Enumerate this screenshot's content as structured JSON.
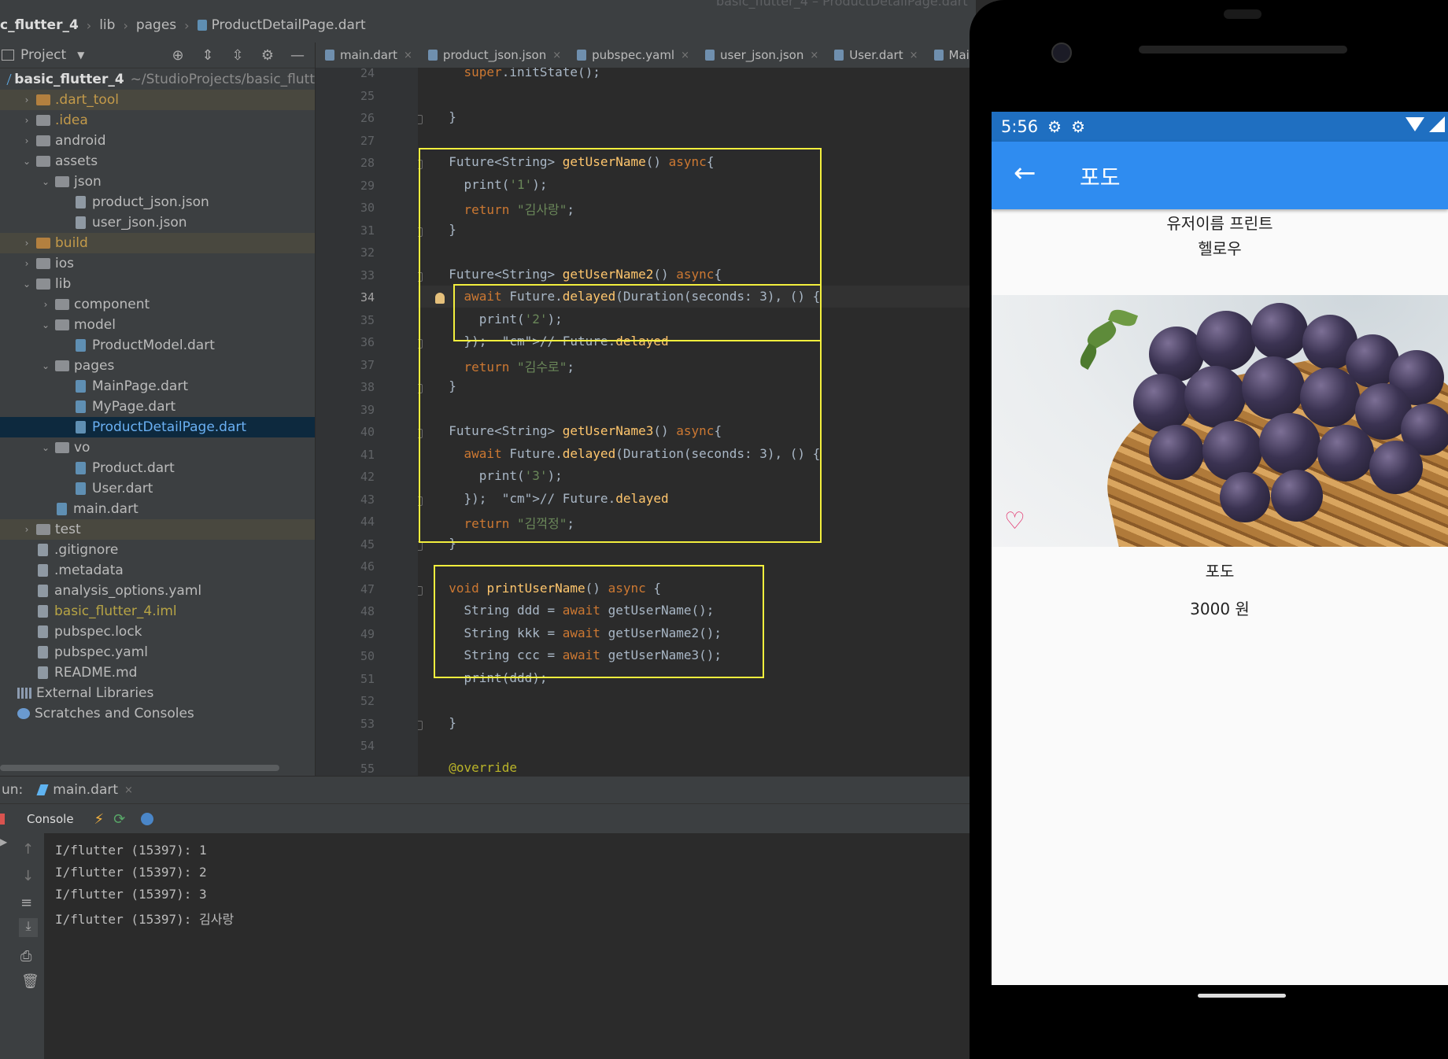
{
  "breadcrumb": [
    "c_flutter_4",
    "lib",
    "pages",
    "ProductDetailPage.dart"
  ],
  "window_title_faint": "basic_flutter_4 – ProductDetailPage.dart",
  "project_pane": {
    "title": "Project",
    "tree": [
      {
        "label": "basic_flutter_4",
        "suffix": "~/StudioProjects/basic_flutt",
        "depth": 0,
        "arrow": "",
        "icon": "flutter",
        "bold": true
      },
      {
        "label": ".dart_tool",
        "depth": 1,
        "arrow": "›",
        "icon": "folder-orange",
        "style": "orange",
        "excluded": true
      },
      {
        "label": ".idea",
        "depth": 1,
        "arrow": "›",
        "icon": "folder",
        "style": "orange"
      },
      {
        "label": "android",
        "depth": 1,
        "arrow": "›",
        "icon": "folder"
      },
      {
        "label": "assets",
        "depth": 1,
        "arrow": "⌄",
        "icon": "folder"
      },
      {
        "label": "json",
        "depth": 2,
        "arrow": "⌄",
        "icon": "folder"
      },
      {
        "label": "product_json.json",
        "depth": 3,
        "arrow": "",
        "icon": "file"
      },
      {
        "label": "user_json.json",
        "depth": 3,
        "arrow": "",
        "icon": "file"
      },
      {
        "label": "build",
        "depth": 1,
        "arrow": "›",
        "icon": "folder-orange",
        "style": "orange",
        "excluded": true
      },
      {
        "label": "ios",
        "depth": 1,
        "arrow": "›",
        "icon": "folder"
      },
      {
        "label": "lib",
        "depth": 1,
        "arrow": "⌄",
        "icon": "folder"
      },
      {
        "label": "component",
        "depth": 2,
        "arrow": "›",
        "icon": "folder"
      },
      {
        "label": "model",
        "depth": 2,
        "arrow": "⌄",
        "icon": "folder"
      },
      {
        "label": "ProductModel.dart",
        "depth": 3,
        "arrow": "",
        "icon": "dart"
      },
      {
        "label": "pages",
        "depth": 2,
        "arrow": "⌄",
        "icon": "folder"
      },
      {
        "label": "MainPage.dart",
        "depth": 3,
        "arrow": "",
        "icon": "dart"
      },
      {
        "label": "MyPage.dart",
        "depth": 3,
        "arrow": "",
        "icon": "dart"
      },
      {
        "label": "ProductDetailPage.dart",
        "depth": 3,
        "arrow": "",
        "icon": "dart",
        "style": "blue",
        "selected": true
      },
      {
        "label": "vo",
        "depth": 2,
        "arrow": "⌄",
        "icon": "folder"
      },
      {
        "label": "Product.dart",
        "depth": 3,
        "arrow": "",
        "icon": "dart"
      },
      {
        "label": "User.dart",
        "depth": 3,
        "arrow": "",
        "icon": "dart"
      },
      {
        "label": "main.dart",
        "depth": 2,
        "arrow": "",
        "icon": "dart"
      },
      {
        "label": "test",
        "depth": 1,
        "arrow": "›",
        "icon": "folder",
        "excluded": true
      },
      {
        "label": ".gitignore",
        "depth": 1,
        "arrow": "",
        "icon": "file"
      },
      {
        "label": ".metadata",
        "depth": 1,
        "arrow": "",
        "icon": "file"
      },
      {
        "label": "analysis_options.yaml",
        "depth": 1,
        "arrow": "",
        "icon": "file"
      },
      {
        "label": "basic_flutter_4.iml",
        "depth": 1,
        "arrow": "",
        "icon": "file",
        "style": "gold"
      },
      {
        "label": "pubspec.lock",
        "depth": 1,
        "arrow": "",
        "icon": "file"
      },
      {
        "label": "pubspec.yaml",
        "depth": 1,
        "arrow": "",
        "icon": "file"
      },
      {
        "label": "README.md",
        "depth": 1,
        "arrow": "",
        "icon": "file"
      },
      {
        "label": "External Libraries",
        "depth": 0,
        "arrow": "",
        "icon": "libs"
      },
      {
        "label": "Scratches and Consoles",
        "depth": 0,
        "arrow": "",
        "icon": "scratch"
      }
    ]
  },
  "editor_tabs": [
    "main.dart",
    "product_json.json",
    "pubspec.yaml",
    "user_json.json",
    "User.dart",
    "MainP"
  ],
  "code": {
    "current_line": "34",
    "lines": [
      {
        "n": "24",
        "t": "    super.initState();"
      },
      {
        "n": "25",
        "t": ""
      },
      {
        "n": "26",
        "t": "  }"
      },
      {
        "n": "27",
        "t": ""
      },
      {
        "n": "28",
        "t": "  Future<String> getUserName() async{"
      },
      {
        "n": "29",
        "t": "    print('1');"
      },
      {
        "n": "30",
        "t": "    return \"김사랑\";"
      },
      {
        "n": "31",
        "t": "  }"
      },
      {
        "n": "32",
        "t": ""
      },
      {
        "n": "33",
        "t": "  Future<String> getUserName2() async{"
      },
      {
        "n": "34",
        "t": "    await Future.delayed(Duration(seconds: 3), () {"
      },
      {
        "n": "35",
        "t": "      print('2');"
      },
      {
        "n": "36",
        "t": "    });  // Future.delayed"
      },
      {
        "n": "37",
        "t": "    return \"김수로\";"
      },
      {
        "n": "38",
        "t": "  }"
      },
      {
        "n": "39",
        "t": ""
      },
      {
        "n": "40",
        "t": "  Future<String> getUserName3() async{"
      },
      {
        "n": "41",
        "t": "    await Future.delayed(Duration(seconds: 3), () {"
      },
      {
        "n": "42",
        "t": "      print('3');"
      },
      {
        "n": "43",
        "t": "    });  // Future.delayed"
      },
      {
        "n": "44",
        "t": "    return \"김꺽정\";"
      },
      {
        "n": "45",
        "t": "  }"
      },
      {
        "n": "46",
        "t": ""
      },
      {
        "n": "47",
        "t": "  void printUserName() async {"
      },
      {
        "n": "48",
        "t": "    String ddd = await getUserName();"
      },
      {
        "n": "49",
        "t": "    String kkk = await getUserName2();"
      },
      {
        "n": "50",
        "t": "    String ccc = await getUserName3();"
      },
      {
        "n": "51",
        "t": "    print(ddd);"
      },
      {
        "n": "52",
        "t": ""
      },
      {
        "n": "53",
        "t": "  }"
      },
      {
        "n": "54",
        "t": ""
      },
      {
        "n": "55",
        "t": "  @override"
      }
    ]
  },
  "run_panel": {
    "label": "un:",
    "tab": "main.dart",
    "console_label": "Console",
    "logs": [
      "I/flutter (15397): 1",
      "I/flutter (15397): 2",
      "I/flutter (15397): 3",
      "I/flutter (15397): 김사랑"
    ]
  },
  "phone": {
    "time": "5:56",
    "appbar_title": "포도",
    "header_line1": "유저이름 프린트",
    "header_line2": "헬로우",
    "product_name": "포도",
    "price": "3000 원"
  },
  "colors": {
    "highlight_box": "#f3ef3d",
    "appbar": "#2f8cf0",
    "statusbar": "#1f6fc1",
    "heart": "#e33a72"
  }
}
